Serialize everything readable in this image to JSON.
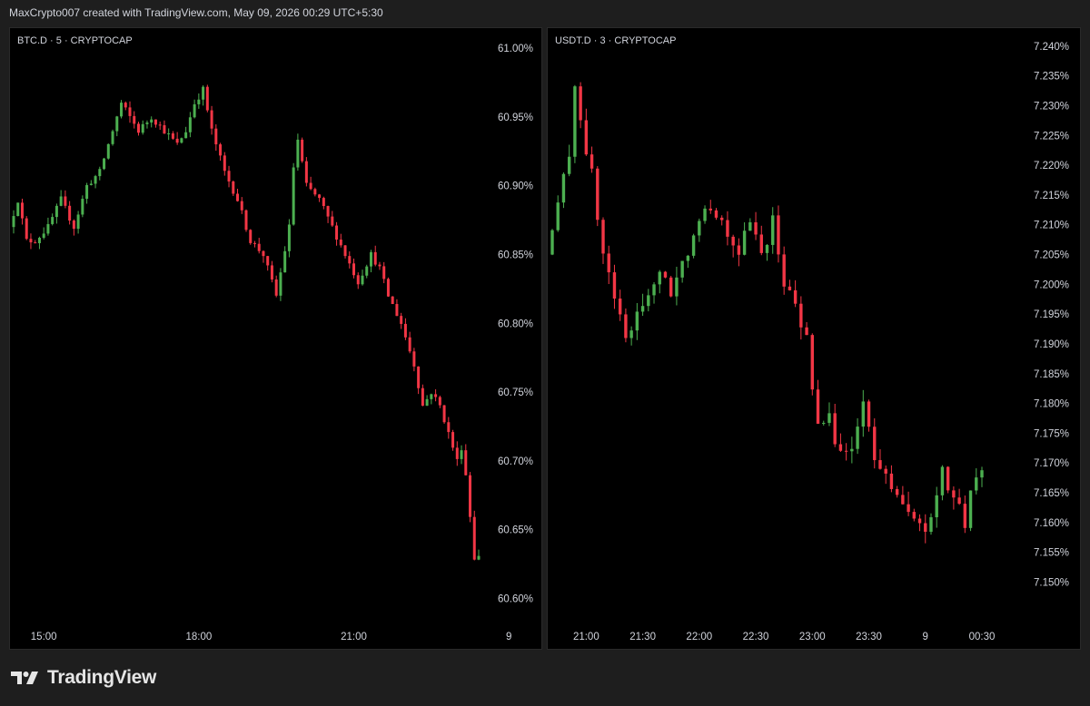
{
  "header": {
    "text": "MaxCrypto007 created with TradingView.com, May 09, 2026 00:29 UTC+5:30"
  },
  "footer": {
    "brand": "TradingView",
    "logo_icon": "tradingview-logo-icon"
  },
  "colors": {
    "up": "#4caf50",
    "down": "#f23645",
    "background": "#000000",
    "frame": "#1e1e1e",
    "text": "#d1d4dc"
  },
  "chart_data": [
    {
      "type": "candlestick",
      "title": "BTC.D · 5 · CRYPTOCAP",
      "ylim": [
        60.595,
        61.008
      ],
      "y_ticks": [
        {
          "value": 61.0,
          "label": "61.00%"
        },
        {
          "value": 60.95,
          "label": "60.95%"
        },
        {
          "value": 60.9,
          "label": "60.90%"
        },
        {
          "value": 60.85,
          "label": "60.85%"
        },
        {
          "value": 60.8,
          "label": "60.80%"
        },
        {
          "value": 60.75,
          "label": "60.75%"
        },
        {
          "value": 60.7,
          "label": "60.70%"
        },
        {
          "value": 60.65,
          "label": "60.65%"
        },
        {
          "value": 60.6,
          "label": "60.60%"
        }
      ],
      "x_range": [
        "14:25",
        "23:25"
      ],
      "x_ticks": [
        "15:00",
        "18:00",
        "21:00",
        "9"
      ],
      "anchors": [
        [
          "14:25",
          60.87
        ],
        [
          "14:35",
          60.89
        ],
        [
          "14:45",
          60.86
        ],
        [
          "14:55",
          60.86
        ],
        [
          "15:10",
          60.87
        ],
        [
          "15:25",
          60.89
        ],
        [
          "15:40",
          60.87
        ],
        [
          "15:55",
          60.9
        ],
        [
          "16:10",
          60.91
        ],
        [
          "16:25",
          60.94
        ],
        [
          "16:35",
          60.96
        ],
        [
          "16:45",
          60.95
        ],
        [
          "16:55",
          60.94
        ],
        [
          "17:10",
          60.95
        ],
        [
          "17:25",
          60.94
        ],
        [
          "17:40",
          60.93
        ],
        [
          "17:50",
          60.94
        ],
        [
          "18:00",
          60.96
        ],
        [
          "18:10",
          60.97
        ],
        [
          "18:20",
          60.94
        ],
        [
          "18:35",
          60.91
        ],
        [
          "18:50",
          60.89
        ],
        [
          "19:05",
          60.86
        ],
        [
          "19:20",
          60.85
        ],
        [
          "19:35",
          60.82
        ],
        [
          "19:50",
          60.87
        ],
        [
          "19:58",
          60.94
        ],
        [
          "20:10",
          60.9
        ],
        [
          "20:25",
          60.89
        ],
        [
          "20:40",
          60.87
        ],
        [
          "20:55",
          60.85
        ],
        [
          "21:10",
          60.83
        ],
        [
          "21:25",
          60.85
        ],
        [
          "21:35",
          60.84
        ],
        [
          "21:45",
          60.82
        ],
        [
          "22:00",
          60.8
        ],
        [
          "22:15",
          60.77
        ],
        [
          "22:25",
          60.74
        ],
        [
          "22:35",
          60.75
        ],
        [
          "22:45",
          60.74
        ],
        [
          "22:55",
          60.72
        ],
        [
          "23:05",
          60.7
        ],
        [
          "23:10",
          60.71
        ],
        [
          "23:15",
          60.69
        ],
        [
          "23:20",
          60.66
        ],
        [
          "23:25",
          60.63
        ]
      ]
    },
    {
      "type": "candlestick",
      "title": "USDT.D · 3 · CRYPTOCAP",
      "ylim": [
        7.1455,
        7.2415
      ],
      "y_ticks": [
        {
          "value": 7.24,
          "label": "7.240%"
        },
        {
          "value": 7.235,
          "label": "7.235%"
        },
        {
          "value": 7.23,
          "label": "7.230%"
        },
        {
          "value": 7.225,
          "label": "7.225%"
        },
        {
          "value": 7.22,
          "label": "7.220%"
        },
        {
          "value": 7.215,
          "label": "7.215%"
        },
        {
          "value": 7.21,
          "label": "7.210%"
        },
        {
          "value": 7.205,
          "label": "7.205%"
        },
        {
          "value": 7.2,
          "label": "7.200%"
        },
        {
          "value": 7.195,
          "label": "7.195%"
        },
        {
          "value": 7.19,
          "label": "7.190%"
        },
        {
          "value": 7.185,
          "label": "7.185%"
        },
        {
          "value": 7.18,
          "label": "7.180%"
        },
        {
          "value": 7.175,
          "label": "7.175%"
        },
        {
          "value": 7.17,
          "label": "7.170%"
        },
        {
          "value": 7.165,
          "label": "7.165%"
        },
        {
          "value": 7.16,
          "label": "7.160%"
        },
        {
          "value": 7.155,
          "label": "7.155%"
        },
        {
          "value": 7.15,
          "label": "7.150%"
        }
      ],
      "x_range": [
        "20:42",
        "00:32"
      ],
      "x_ticks": [
        "21:00",
        "21:30",
        "22:00",
        "22:30",
        "23:00",
        "23:30",
        "9",
        "00:30"
      ],
      "anchors": [
        [
          "20:42",
          7.205
        ],
        [
          "20:48",
          7.213
        ],
        [
          "20:54",
          7.222
        ],
        [
          "20:57",
          7.234
        ],
        [
          "21:00",
          7.228
        ],
        [
          "21:06",
          7.218
        ],
        [
          "21:12",
          7.205
        ],
        [
          "21:18",
          7.198
        ],
        [
          "21:24",
          7.19
        ],
        [
          "21:30",
          7.195
        ],
        [
          "21:36",
          7.199
        ],
        [
          "21:42",
          7.201
        ],
        [
          "21:48",
          7.199
        ],
        [
          "21:54",
          7.203
        ],
        [
          "22:00",
          7.209
        ],
        [
          "22:06",
          7.214
        ],
        [
          "22:12",
          7.212
        ],
        [
          "22:18",
          7.209
        ],
        [
          "22:24",
          7.206
        ],
        [
          "22:30",
          7.21
        ],
        [
          "22:36",
          7.205
        ],
        [
          "22:42",
          7.211
        ],
        [
          "22:48",
          7.2
        ],
        [
          "22:54",
          7.196
        ],
        [
          "23:00",
          7.191
        ],
        [
          "23:06",
          7.176
        ],
        [
          "23:12",
          7.177
        ],
        [
          "23:18",
          7.172
        ],
        [
          "23:24",
          7.172
        ],
        [
          "23:30",
          7.18
        ],
        [
          "23:36",
          7.17
        ],
        [
          "23:42",
          7.168
        ],
        [
          "23:48",
          7.165
        ],
        [
          "23:54",
          7.161
        ],
        [
          "00:00",
          7.159
        ],
        [
          "00:06",
          7.16
        ],
        [
          "00:12",
          7.168
        ],
        [
          "00:18",
          7.164
        ],
        [
          "00:24",
          7.16
        ],
        [
          "00:30",
          7.168
        ]
      ]
    }
  ]
}
